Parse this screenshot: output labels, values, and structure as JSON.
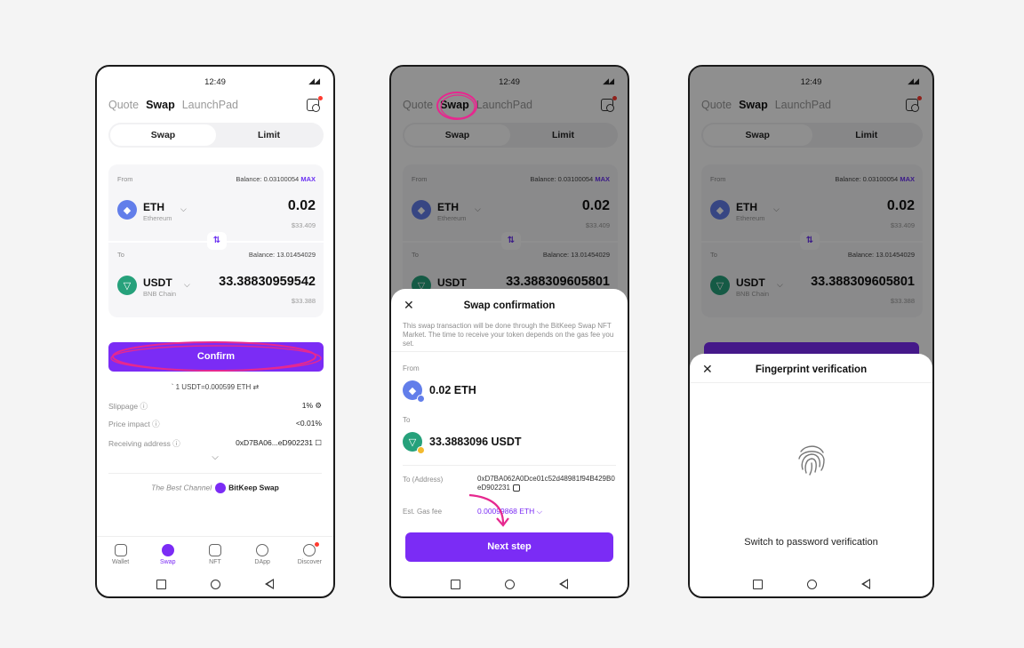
{
  "status": {
    "time": "12:49",
    "signal": "◢◢"
  },
  "nav": {
    "tabs": [
      "Quote",
      "Swap",
      "LaunchPad"
    ],
    "active": "Swap"
  },
  "segment": {
    "swap": "Swap",
    "limit": "Limit"
  },
  "from": {
    "label": "From",
    "balance_prefix": "Balance: 0.03100054",
    "max": "MAX",
    "symbol": "ETH",
    "chain": "Ethereum",
    "amount": "0.02",
    "usd": "$33.409"
  },
  "to": {
    "label": "To",
    "balance": "Balance: 13.01454029",
    "symbol": "USDT",
    "chain": "BNB Chain",
    "amount": "33.38830959542",
    "amount_p2": "33.388309605801",
    "usd": "$33.388"
  },
  "confirm_label": "Confirm",
  "rate": "` 1 USDT=0.000599 ETH ⇄",
  "details": {
    "slippage_label": "Slippage ⓘ",
    "slippage_value": "1% ⚙",
    "impact_label": "Price impact ⓘ",
    "impact_value": "<0.01%",
    "receiving_label": "Receiving address ⓘ",
    "receiving_value": "0xD7BA06...eD902231 ☐"
  },
  "channel": {
    "prefix": "The Best Channel",
    "brand": "BitKeep Swap"
  },
  "bottom_nav": [
    "Wallet",
    "Swap",
    "NFT",
    "DApp",
    "Discover"
  ],
  "swap_confirm": {
    "title": "Swap confirmation",
    "close": "✕",
    "description": "This swap transaction will be done through the BitKeep Swap NFT Market. The time to receive your token depends on the gas fee you set.",
    "from_label": "From",
    "from_amount": "0.02 ETH",
    "to_label": "To",
    "to_amount": "33.3883096 USDT",
    "address_label": "To (Address)",
    "address": "0xD7BA062A0Dce01c52d48981f94B429B0eD902231",
    "gas_label": "Est. Gas fee",
    "gas_value": "0.00099868 ETH ⌵",
    "next": "Next step"
  },
  "fingerprint": {
    "title": "Fingerprint verification",
    "close": "✕",
    "switch": "Switch to password verification"
  },
  "colors": {
    "accent": "#7b2cf5",
    "annotation": "#e6288f"
  }
}
